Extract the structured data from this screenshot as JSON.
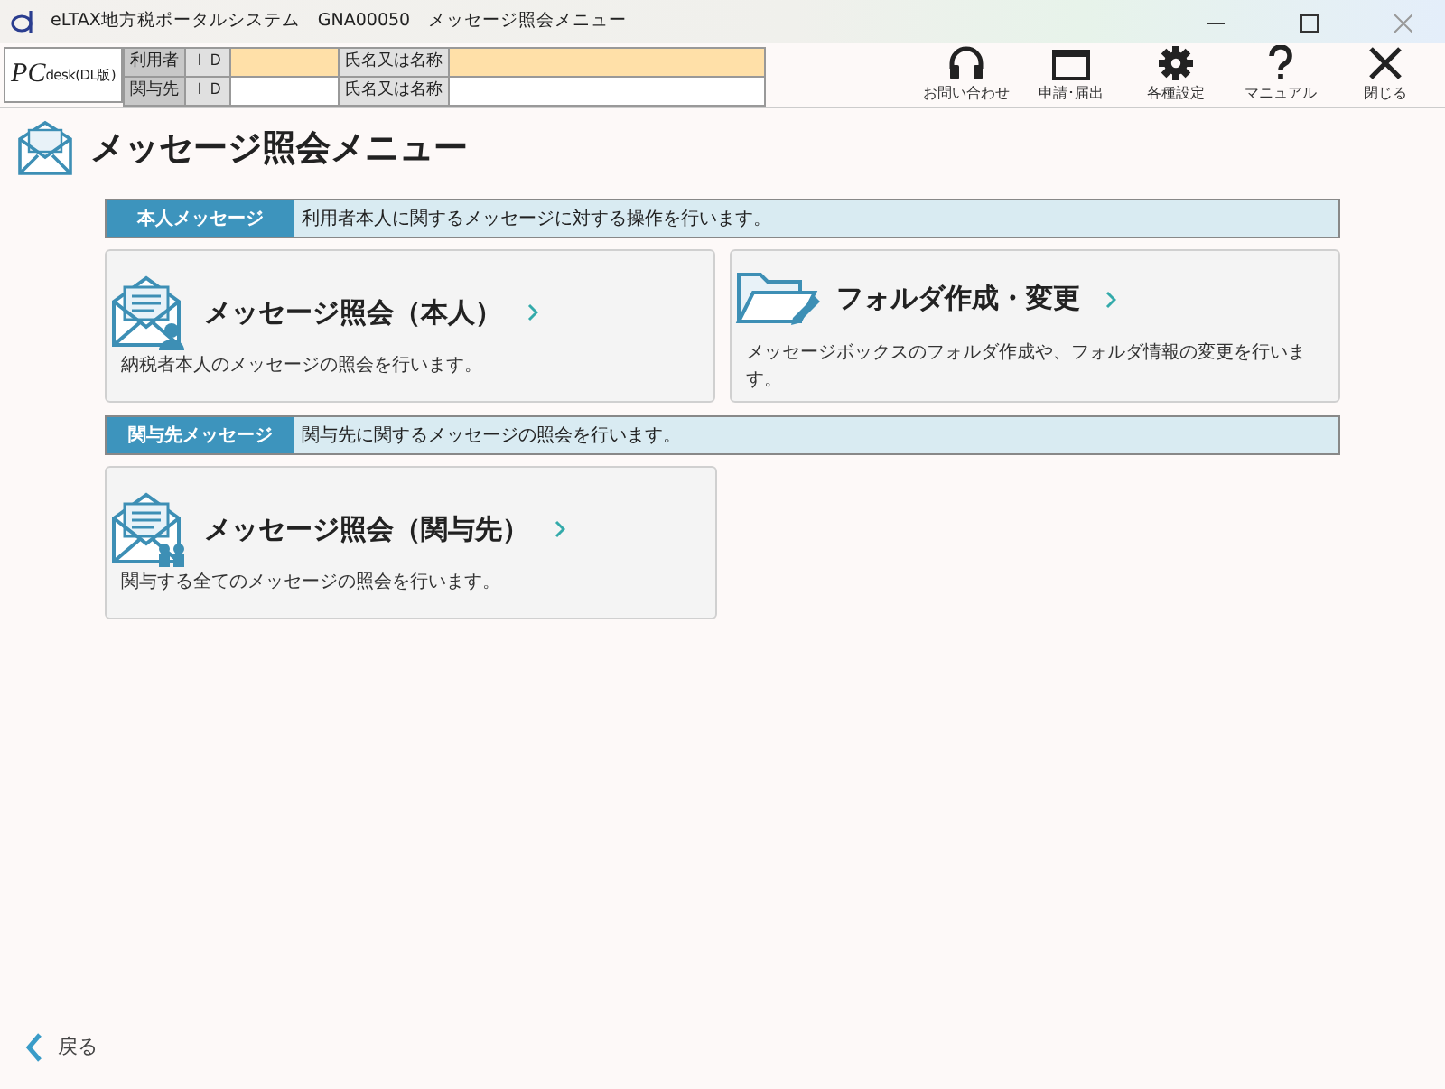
{
  "window": {
    "title": "eLTAX地方税ポータルシステム　GNA00050　メッセージ照会メニュー"
  },
  "header": {
    "logo_main": "PC",
    "logo_sub": "desk(DL版)",
    "rows": [
      {
        "label": "利用者",
        "id_label": "ＩＤ",
        "name_label": "氏名又は名称",
        "highlighted": true
      },
      {
        "label": "関与先",
        "id_label": "ＩＤ",
        "name_label": "氏名又は名称",
        "highlighted": false
      }
    ]
  },
  "toolbar": [
    {
      "kind": "headset",
      "label": "お問い合わせ"
    },
    {
      "kind": "window",
      "label": "申請･届出"
    },
    {
      "kind": "gear",
      "label": "各種設定"
    },
    {
      "kind": "help",
      "label": "マニュアル"
    },
    {
      "kind": "close",
      "label": "閉じる"
    }
  ],
  "page_title": "メッセージ照会メニュー",
  "sections": [
    {
      "label": "本人メッセージ",
      "description": "利用者本人に関するメッセージに対する操作を行います。",
      "cards": [
        {
          "kind": "envelope-person",
          "title": "メッセージ照会（本人）",
          "description": "納税者本人のメッセージの照会を行います。"
        },
        {
          "kind": "folder",
          "title": "フォルダ作成・変更",
          "description": "メッセージボックスのフォルダ作成や、フォルダ情報の変更を行います。"
        }
      ]
    },
    {
      "label": "関与先メッセージ",
      "description": "関与先に関するメッセージの照会を行います。",
      "cards": [
        {
          "kind": "envelope-group",
          "title": "メッセージ照会（関与先）",
          "description": "関与する全てのメッセージの照会を行います。"
        }
      ]
    }
  ],
  "back": "戻る"
}
